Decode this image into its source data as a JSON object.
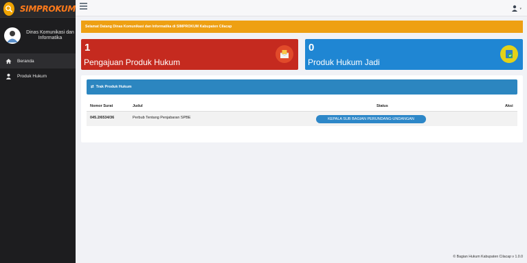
{
  "brand": {
    "name": "SIMPROKUM"
  },
  "profile": {
    "name": "Dinas Komunikasi dan Informatika"
  },
  "sidebar": {
    "items": [
      {
        "label": "Beranda",
        "icon": "home-icon",
        "active": true
      },
      {
        "label": "Produk Hukum",
        "icon": "user-icon",
        "active": false
      }
    ]
  },
  "welcome": {
    "text": "Selamat Datang Dinas Komunikasi dan Informatika di SIMPROKUM Kabupaten Cilacap"
  },
  "cards": [
    {
      "count": "1",
      "label": "Pengajuan Produk Hukum",
      "color": "#c52a1f",
      "icon": "envelope-icon"
    },
    {
      "count": "0",
      "label": "Produk Hukum Jadi",
      "color": "#1f86d3",
      "icon": "document-check-icon"
    }
  ],
  "track": {
    "title": "Trak Produk Hukum",
    "columns": [
      "Nomor Surat",
      "Judul",
      "Status",
      "Aksi"
    ],
    "rows": [
      {
        "nomor": "045.2/6534/36",
        "judul": "Perbub Tentang Penjabaran SPBE",
        "status": "KEPALA SUB BAGIAN PERUNDANG-UNDANGAN"
      }
    ]
  },
  "footer": {
    "text": "© Bagian Hukum Kabupaten Cilacap v 1.0.0"
  },
  "colors": {
    "accent": "#eea013",
    "danger": "#c52a1f",
    "primary": "#1f86d3",
    "header": "#2c86c0",
    "sidebar": "#1d1d1f"
  }
}
